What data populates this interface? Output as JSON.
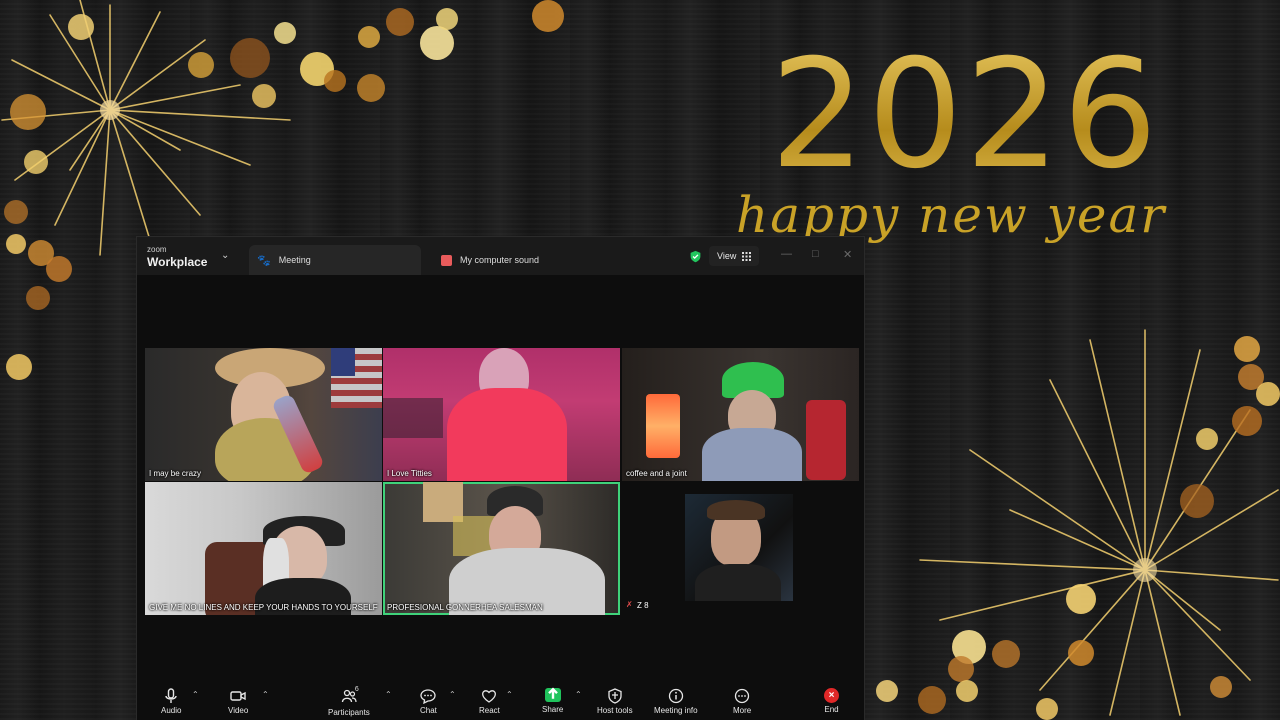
{
  "wallpaper": {
    "year": "2026",
    "greeting": "happy new year"
  },
  "window": {
    "brand_small": "zoom",
    "brand_large": "Workplace",
    "tabs": [
      {
        "label": "Meeting",
        "icon": "paw-icon"
      },
      {
        "label": "My computer sound",
        "icon": "app-icon"
      }
    ],
    "view_label": "View"
  },
  "participants": [
    {
      "name": "I may be crazy",
      "active": false
    },
    {
      "name": "I Love Titties",
      "active": false
    },
    {
      "name": "coffee and a joint",
      "active": false
    },
    {
      "name": "GIVE ME NO LINES AND KEEP YOUR HANDS TO YOURSELF",
      "active": false
    },
    {
      "name": "PROFESIONAL GONNERHEA SALESMAN",
      "active": true
    },
    {
      "name": "Z 8",
      "active": false,
      "muted": true
    }
  ],
  "toolbar": {
    "audio": "Audio",
    "video": "Video",
    "participants": "Participants",
    "participants_count": "6",
    "chat": "Chat",
    "react": "React",
    "share": "Share",
    "host_tools": "Host tools",
    "meeting_info": "Meeting info",
    "more": "More",
    "end": "End"
  },
  "colors": {
    "gold": "#c9a227",
    "active_speaker": "#3fd27a",
    "share_green": "#20c35c",
    "end_red": "#e02828"
  }
}
